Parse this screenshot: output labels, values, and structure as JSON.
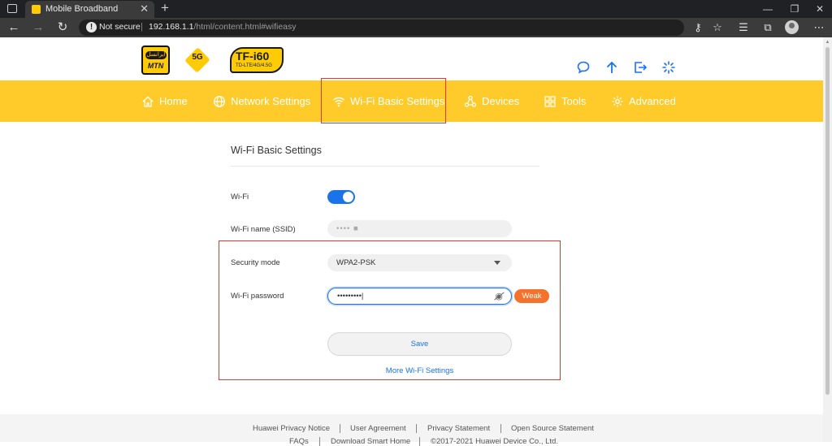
{
  "browser": {
    "tab_title": "Mobile Broadband",
    "tab_close": "✕",
    "new_tab": "+",
    "not_secure": "Not secure",
    "url_host": "192.168.1.1",
    "url_path": "/html/content.html#wifieasy"
  },
  "header": {
    "mtn_farsi": "ایرانسل",
    "mtn_label": "MTN",
    "logo_5g": "5G",
    "model": "TF-i60",
    "model_sub": "TD-LTE/4G/4.5G"
  },
  "nav": {
    "items": [
      {
        "label": "Home",
        "icon": "home-icon"
      },
      {
        "label": "Network Settings",
        "icon": "globe-icon"
      },
      {
        "label": "Wi-Fi Basic Settings",
        "icon": "wifi-icon"
      },
      {
        "label": "Devices",
        "icon": "devices-icon"
      },
      {
        "label": "Tools",
        "icon": "tools-icon"
      },
      {
        "label": "Advanced",
        "icon": "gear-icon"
      }
    ]
  },
  "content": {
    "title": "Wi-Fi Basic Settings",
    "wifi_label": "Wi-Fi",
    "wifi_enabled": true,
    "ssid_label": "Wi-Fi name (SSID)",
    "ssid_value": "•••• ■",
    "security_label": "Security mode",
    "security_value": "WPA2-PSK",
    "password_label": "Wi-Fi password",
    "password_value": "•••••••••|",
    "strength_badge": "Weak",
    "save_label": "Save",
    "more_link": "More Wi-Fi Settings"
  },
  "footer": {
    "links_row1": [
      "Huawei Privacy Notice",
      "User Agreement",
      "Privacy Statement",
      "Open Source Statement"
    ],
    "links_row2": [
      "FAQs",
      "Download Smart Home",
      "©2017-2021 Huawei Device Co., Ltd."
    ]
  },
  "colors": {
    "accent": "#ffcb2b",
    "link_blue": "#1a73e8",
    "badge_orange": "#f4722b",
    "highlight_red": "#e53935"
  }
}
